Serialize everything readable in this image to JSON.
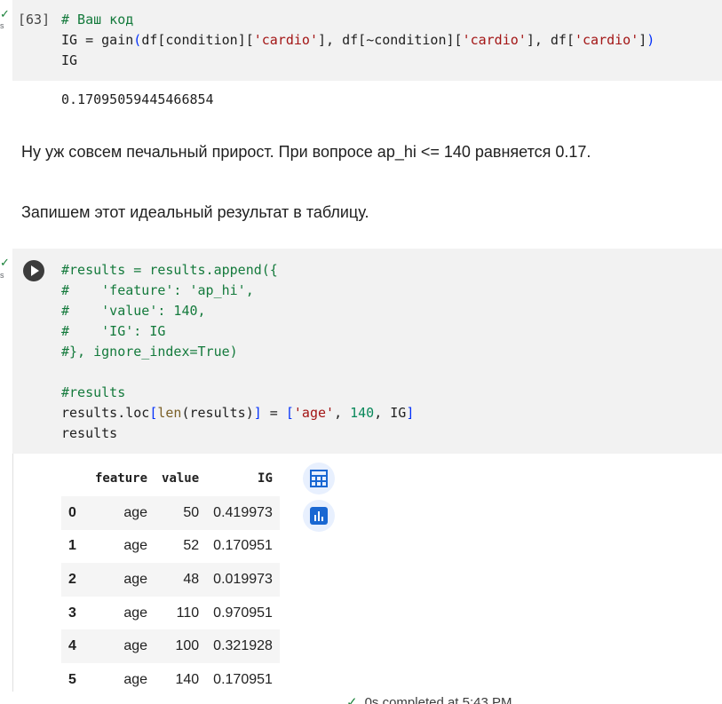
{
  "cell1": {
    "exec_count": "[63]",
    "lines": [
      [
        {
          "t": "# Ваш код",
          "c": "cm"
        }
      ],
      [
        {
          "t": "IG = "
        },
        {
          "t": "gain",
          "c": ""
        },
        {
          "t": "(",
          "c": "br"
        },
        {
          "t": "df"
        },
        {
          "t": "[",
          "c": ""
        },
        {
          "t": "condition"
        },
        {
          "t": "]["
        },
        {
          "t": "'cardio'",
          "c": "str"
        },
        {
          "t": "], df["
        },
        {
          "t": "~condition"
        },
        {
          "t": "]["
        },
        {
          "t": "'cardio'",
          "c": "str"
        },
        {
          "t": "], df["
        },
        {
          "t": "'cardio'",
          "c": "str"
        },
        {
          "t": "]"
        },
        {
          "t": ")",
          "c": "br"
        }
      ],
      [
        {
          "t": "IG"
        }
      ]
    ],
    "output": "0.17095059445466854"
  },
  "markdown": [
    "Ну уж совсем печальный прирост. При вопросе ap_hi <= 140 равняется 0.17.",
    "Запишем этот идеальный результат в таблицу."
  ],
  "cell2": {
    "lines": [
      [
        {
          "t": "#results = results.append({",
          "c": "cm"
        }
      ],
      [
        {
          "t": "#    'feature': 'ap_hi',",
          "c": "cm"
        }
      ],
      [
        {
          "t": "#    'value': 140,",
          "c": "cm"
        }
      ],
      [
        {
          "t": "#    'IG': IG",
          "c": "cm"
        }
      ],
      [
        {
          "t": "#}, ignore_index=True)",
          "c": "cm"
        }
      ],
      [
        {
          "t": ""
        }
      ],
      [
        {
          "t": "#results",
          "c": "cm"
        }
      ],
      [
        {
          "t": "results.loc"
        },
        {
          "t": "[",
          "c": "br"
        },
        {
          "t": "len",
          "c": "fn"
        },
        {
          "t": "(results)"
        },
        {
          "t": "]",
          "c": "br"
        },
        {
          "t": " = "
        },
        {
          "t": "[",
          "c": "br"
        },
        {
          "t": "'age'",
          "c": "str"
        },
        {
          "t": ", "
        },
        {
          "t": "140",
          "c": "num"
        },
        {
          "t": ", IG"
        },
        {
          "t": "]",
          "c": "br"
        }
      ],
      [
        {
          "t": "results"
        }
      ]
    ]
  },
  "dataframe": {
    "columns": [
      "",
      "feature",
      "value",
      "IG"
    ],
    "rows": [
      [
        "0",
        "age",
        "50",
        "0.419973"
      ],
      [
        "1",
        "age",
        "52",
        "0.170951"
      ],
      [
        "2",
        "age",
        "48",
        "0.019973"
      ],
      [
        "3",
        "age",
        "110",
        "0.970951"
      ],
      [
        "4",
        "age",
        "100",
        "0.321928"
      ],
      [
        "5",
        "age",
        "140",
        "0.170951"
      ]
    ]
  },
  "icons": {
    "table_button": "table-icon",
    "chart_button": "bar-chart-icon",
    "run_button": "play-icon",
    "accent": "#1967d2"
  },
  "status": {
    "check": "✓",
    "text": "0s    completed at 5:43 PM"
  },
  "gutter": {
    "check": "✓",
    "s": "s"
  }
}
